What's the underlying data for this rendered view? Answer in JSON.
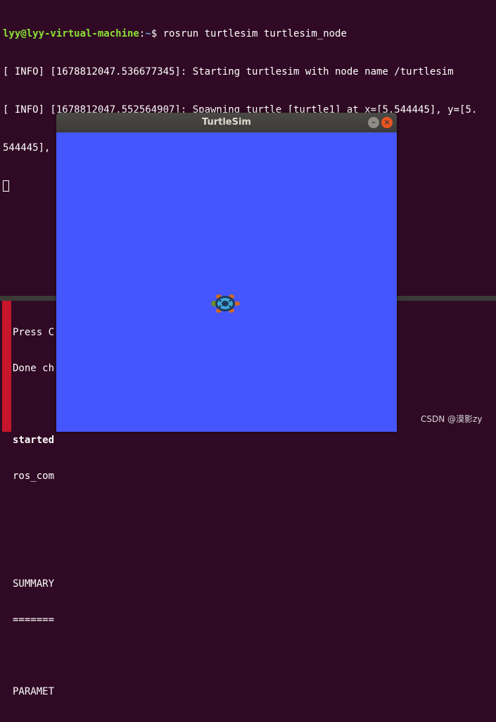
{
  "terminal_top": {
    "prompt_user": "lyy@lyy-virtual-machine",
    "prompt_path": "~",
    "prompt_symbol": "$",
    "command": "rosrun turtlesim turtlesim_node",
    "lines": [
      "[ INFO] [1678812047.536677345]: Starting turtlesim with node name /turtlesim",
      "[ INFO] [1678812047.552564907]: Spawning turtle [turtle1] at x=[5.544445], y=[5.",
      "544445], theta=[0.000000]"
    ]
  },
  "terminal_bottom": {
    "lines": [
      {
        "text": "Press C",
        "bold": false
      },
      {
        "text": "Done ch",
        "bold": false
      },
      {
        "text": "",
        "bold": false
      },
      {
        "text": "started",
        "bold": true
      },
      {
        "text": "ros_com",
        "bold": false
      },
      {
        "text": "",
        "bold": false
      },
      {
        "text": "",
        "bold": false
      },
      {
        "text": "SUMMARY",
        "bold": false
      },
      {
        "text": "=======",
        "bold": false
      },
      {
        "text": "",
        "bold": false
      },
      {
        "text": "PARAMET",
        "bold": false
      }
    ]
  },
  "window": {
    "title": "TurtleSim",
    "minimize_label": "–",
    "close_label": "×",
    "canvas_color": "#4556ff",
    "turtle": {
      "x": 5.544445,
      "y": 5.544445,
      "theta": 0.0
    }
  },
  "watermark": "CSDN @漠影zy",
  "colors": {
    "terminal_bg": "#300a24",
    "prompt_user": "#8ae234",
    "prompt_path": "#729fcf",
    "close_button": "#e95420"
  }
}
